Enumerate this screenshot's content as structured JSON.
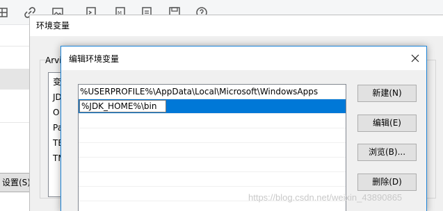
{
  "toolbar": {
    "icons": [
      "table-icon",
      "link-icon",
      "image-icon",
      "code-insert-icon",
      "formula-icon",
      "document-icon",
      "save-icon",
      "help-icon"
    ]
  },
  "background": {
    "left_button_label": "设置(S)..."
  },
  "env_window": {
    "title": "环境变量",
    "group_label": "Arvi",
    "list_items": [
      "变",
      "JD",
      "O",
      "Pa",
      "TE",
      "TM"
    ]
  },
  "edit_dialog": {
    "title": "编辑环境变量",
    "paths": [
      "%USERPROFILE%\\AppData\\Local\\Microsoft\\WindowsApps"
    ],
    "editing_value": "%JDK_HOME%\\bin",
    "buttons": {
      "new": "新建(N)",
      "edit": "编辑(E)",
      "browse": "浏览(B)...",
      "delete": "删除(D)"
    }
  },
  "watermark": "https://blog.csdn.net/weixin_43890865",
  "colors": {
    "selection": "#0078d7",
    "dialog_border": "#1c84d8",
    "button_face": "#e1e1e1"
  }
}
